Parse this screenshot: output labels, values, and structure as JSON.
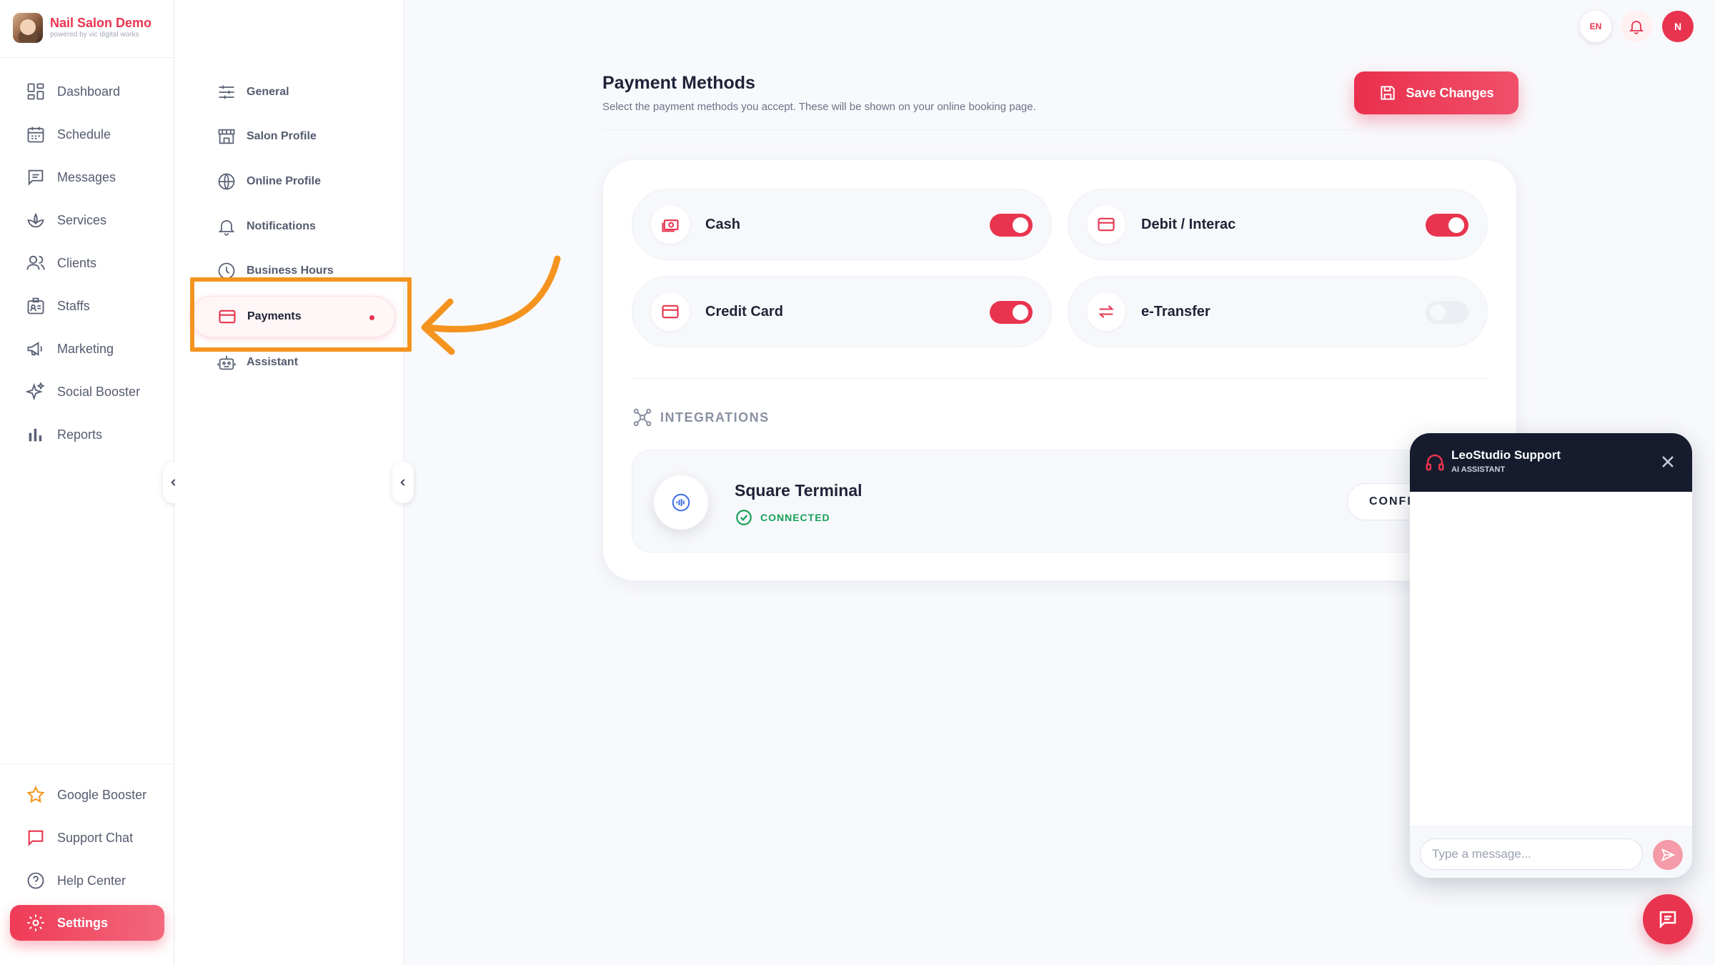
{
  "brand": {
    "name": "Nail Salon Demo",
    "tagline": "powered by vic digital works"
  },
  "sidebar": {
    "items": [
      {
        "label": "Dashboard",
        "icon": "dashboard-icon"
      },
      {
        "label": "Schedule",
        "icon": "calendar-icon"
      },
      {
        "label": "Messages",
        "icon": "message-icon"
      },
      {
        "label": "Services",
        "icon": "lotus-icon"
      },
      {
        "label": "Clients",
        "icon": "users-icon"
      },
      {
        "label": "Staffs",
        "icon": "id-badge-icon"
      },
      {
        "label": "Marketing",
        "icon": "megaphone-icon"
      },
      {
        "label": "Social Booster",
        "icon": "sparkles-icon"
      },
      {
        "label": "Reports",
        "icon": "bar-chart-icon"
      }
    ],
    "bottom_items": [
      {
        "label": "Google Booster",
        "icon": "star-icon"
      },
      {
        "label": "Support Chat",
        "icon": "chat-bubble-icon"
      },
      {
        "label": "Help Center",
        "icon": "help-circle-icon"
      },
      {
        "label": "Settings",
        "icon": "gear-icon",
        "active": true
      }
    ]
  },
  "settings_nav": {
    "items": [
      {
        "label": "General",
        "icon": "sliders-icon"
      },
      {
        "label": "Salon Profile",
        "icon": "storefront-icon"
      },
      {
        "label": "Online Profile",
        "icon": "globe-icon"
      },
      {
        "label": "Notifications",
        "icon": "bell-icon"
      },
      {
        "label": "Business Hours",
        "icon": "clock-icon"
      },
      {
        "label": "Payments",
        "icon": "credit-card-icon",
        "active": true
      },
      {
        "label": "Assistant",
        "icon": "robot-icon"
      }
    ]
  },
  "topbar": {
    "language": "EN",
    "user_initial": "N"
  },
  "page": {
    "title": "Payment Methods",
    "subtitle": "Select the payment methods you accept. These will be shown on your online booking page.",
    "save_label": "Save Changes"
  },
  "payment_methods": [
    {
      "label": "Cash",
      "enabled": true,
      "icon": "cash-icon"
    },
    {
      "label": "Debit / Interac",
      "enabled": true,
      "icon": "card-icon"
    },
    {
      "label": "Credit Card",
      "enabled": true,
      "icon": "card-icon"
    },
    {
      "label": "e-Transfer",
      "enabled": false,
      "icon": "transfer-arrows-icon"
    }
  ],
  "integrations": {
    "heading": "INTEGRATIONS",
    "items": [
      {
        "name": "Square Terminal",
        "status": "CONNECTED",
        "button_label": "CONFI",
        "icon": "terminal-signal-icon"
      }
    ]
  },
  "chat": {
    "title": "LeoStudio Support",
    "subtitle": "AI ASSISTANT",
    "placeholder": "Type a message..."
  },
  "colors": {
    "accent": "#e8344f",
    "annotation": "#f4941f",
    "connected": "#18a05a",
    "chat_header": "#161b2e"
  }
}
